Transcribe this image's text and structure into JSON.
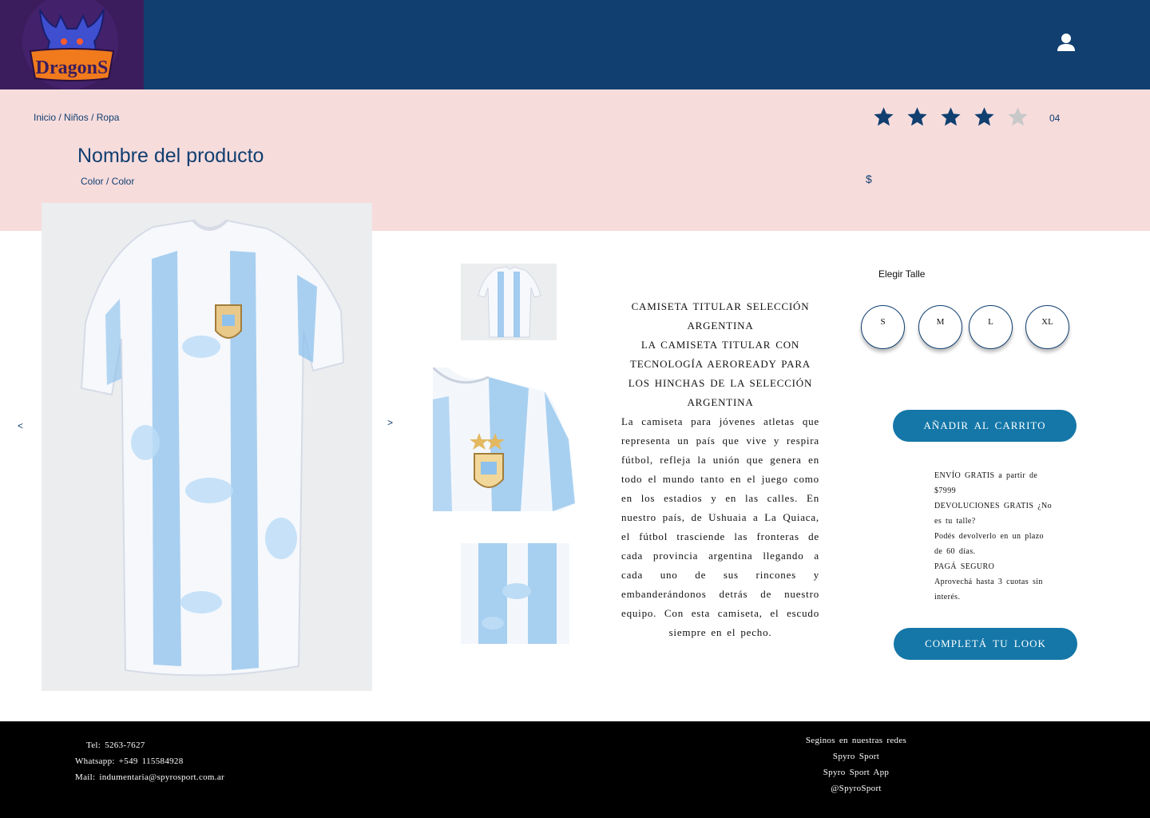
{
  "header": {
    "logo_text": "DragonS",
    "bg_color": "#103f70"
  },
  "breadcrumb": [
    "Inicio",
    "Niños",
    "Ropa"
  ],
  "product": {
    "title": "Nombre del producto",
    "color_label": "Color / Color",
    "price": "$",
    "rating": 4,
    "rating_max": 5,
    "rating_count": "04"
  },
  "gallery": {
    "prev": "<",
    "next": ">"
  },
  "description": {
    "heading_1": "CAMISETA TITULAR SELECCIÓN ARGENTINA",
    "heading_2": "LA CAMISETA TITULAR CON TECNOLOGÍA AEROREADY PARA LOS HINCHAS DE LA SELECCIÓN ARGENTINA",
    "body": "La camiseta para jóvenes atletas que representa un país que vive y respira fútbol, refleja la unión que genera en todo el mundo tanto en el juego como en los estadios y en las calles. En nuestro país, de Ushuaia a La Quiaca, el fútbol trasciende las fronteras de cada provincia argentina llegando a cada uno de sus rincones y embanderándonos detrás de nuestro equipo. Con esta camiseta, el escudo siempre en el pecho."
  },
  "sizes": {
    "title": "Elegir Talle",
    "options": [
      "S",
      "M",
      "L",
      "XL"
    ]
  },
  "actions": {
    "add_to_cart": "AÑADIR AL CARRITO",
    "complete_look": "COMPLETÁ TU LOOK"
  },
  "info": {
    "line_1": "ENVÍO GRATIS a partir de $7999",
    "line_2": "DEVOLUCIONES GRATIS ¿No es tu talle?",
    "line_3": "Podés devolverlo en un plazo de 60 días.",
    "line_4": "PAGÁ SEGURO",
    "line_5": "Aprovechá hasta 3 cuotas sin interés."
  },
  "footer": {
    "tel": "Tel: 5263-7627",
    "whatsapp": "Whatsapp: +549 115584928",
    "mail": "Mail: indumentaria@spyrosport.com.ar",
    "social_title": "Seginos en nuestras redes",
    "social_1": "Spyro Sport",
    "social_2": "Spyro Sport App",
    "social_3": "@SpyroSport"
  },
  "colors": {
    "primary": "#103f70",
    "band": "#f7dcdc",
    "button": "#1477a8",
    "star_empty": "#c8c8c8"
  }
}
